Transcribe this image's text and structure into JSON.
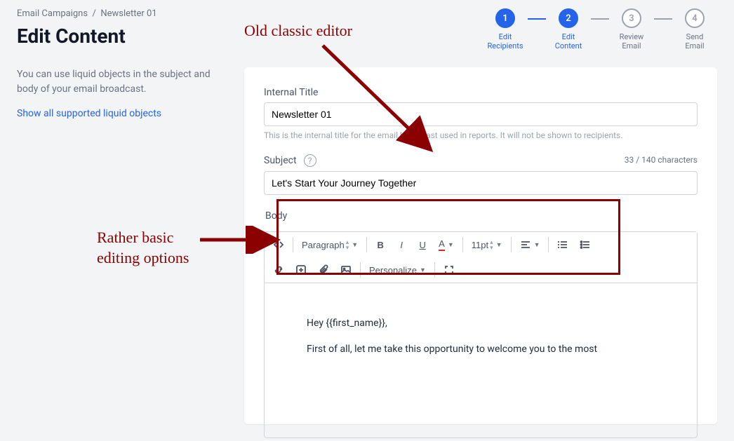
{
  "breadcrumb": {
    "parent": "Email Campaigns",
    "current": "Newsletter 01"
  },
  "page_title": "Edit Content",
  "stepper": [
    {
      "num": "1",
      "line1": "Edit",
      "line2": "Recipients",
      "active": true
    },
    {
      "num": "2",
      "line1": "Edit",
      "line2": "Content",
      "active": true
    },
    {
      "num": "3",
      "line1": "Review",
      "line2": "Email",
      "active": false
    },
    {
      "num": "4",
      "line1": "Send",
      "line2": "Email",
      "active": false
    }
  ],
  "helper_text": "You can use liquid objects in the subject and body of your email broadcast.",
  "liquid_link": "Show all supported liquid objects",
  "internal_title": {
    "label": "Internal Title",
    "value": "Newsletter 01",
    "hint": "This is the internal title for the email broadcast used in reports. It will not be shown to recipients."
  },
  "subject": {
    "label": "Subject",
    "value": "Let's Start Your Journey Together",
    "char_count": "33 / 140 characters"
  },
  "body": {
    "label": "Body",
    "paragraph_style": "Paragraph",
    "font_size": "11pt",
    "personalize": "Personalize",
    "content_line1": "Hey {{first_name}},",
    "content_line2": "First of all, let me take this opportunity to welcome you to the most"
  },
  "annotations": {
    "top": "Old classic editor",
    "left_l1": "Rather basic",
    "left_l2": "editing options"
  }
}
